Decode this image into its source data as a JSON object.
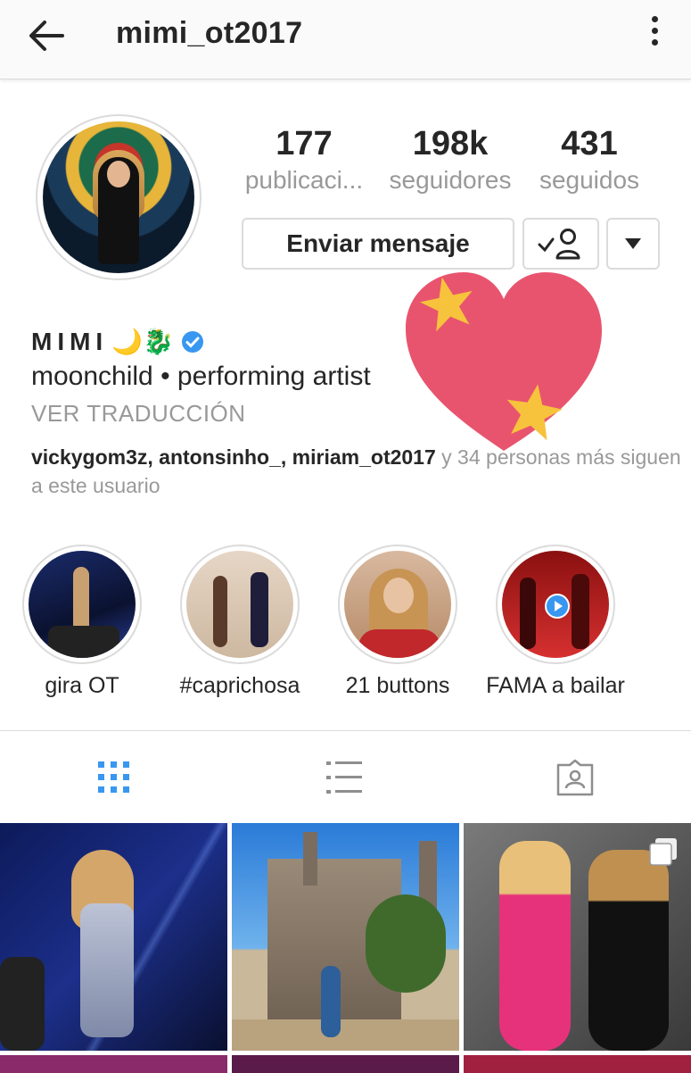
{
  "header": {
    "username": "mimi_ot2017"
  },
  "stats": [
    {
      "value": "177",
      "label": "publicaci..."
    },
    {
      "value": "198k",
      "label": "seguidores"
    },
    {
      "value": "431",
      "label": "seguidos"
    }
  ],
  "buttons": {
    "message": "Enviar mensaje"
  },
  "profile": {
    "name": "MIMI",
    "name_emoji": "🌙🐉",
    "bio": "moonchild • performing artist",
    "translate": "VER TRADUCCIÓN",
    "followed_names": "vickygom3z, antonsinho_, miriam_ot2017",
    "followed_rest": " y 34 personas más siguen a este usuario"
  },
  "highlights": [
    {
      "label": "gira OT"
    },
    {
      "label": "#caprichosa"
    },
    {
      "label": "21 buttons"
    },
    {
      "label": "FAMA a bailar"
    }
  ],
  "colors": {
    "accent": "#3897f0",
    "heart": "#e8546e",
    "star": "#f7c33c"
  }
}
